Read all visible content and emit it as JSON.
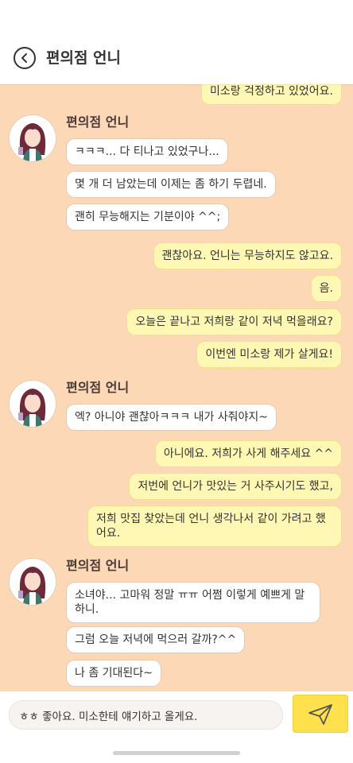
{
  "header": {
    "title": "편의점 언니",
    "back_icon": "chevron-left-icon"
  },
  "chat": {
    "contact_name": "편의점 언니",
    "messages": [
      {
        "side": "out",
        "text": "미소랑 걱정하고 있었어요."
      },
      {
        "side": "in",
        "text": "ㅋㅋㅋ... 다 티나고 있었구나..."
      },
      {
        "side": "in",
        "text": "몇 개 더 남았는데 이제는 좀 하기 두렵네."
      },
      {
        "side": "in",
        "text": "괜히 무능해지는 기분이야 ^^;"
      },
      {
        "side": "out",
        "text": "괜찮아요. 언니는 무능하지도 않고요."
      },
      {
        "side": "out",
        "text": "음."
      },
      {
        "side": "out",
        "text": "오늘은 끝나고 저희랑 같이 저녁 먹을래요?"
      },
      {
        "side": "out",
        "text": "이번엔 미소랑 제가 살게요!"
      },
      {
        "side": "in",
        "text": "엑? 아니야 괜찮아ㅋㅋㅋ 내가 사줘야지~"
      },
      {
        "side": "out",
        "text": "아니에요. 저희가 사게 해주세요 ^^"
      },
      {
        "side": "out",
        "text": "저번에 언니가 맛있는 거 사주시기도 했고,"
      },
      {
        "side": "out",
        "text": "저희 맛집 찾았는데 언니 생각나서 같이 가려고 했어요."
      },
      {
        "side": "in",
        "text": "소녀야... 고마워 정말 ㅠㅠ 어쩜 이렇게 예쁘게 말하니."
      },
      {
        "side": "in",
        "text": "그럼 오늘 저녁에 먹으러 갈까?^^"
      },
      {
        "side": "in",
        "text": "나 좀 기대된다~"
      }
    ]
  },
  "composer": {
    "value": "ㅎㅎ 좋아요. 미소한테 얘기하고 올게요.",
    "send_icon": "paper-plane-icon"
  },
  "colors": {
    "chat_background": "#fcd8b6",
    "outgoing_bubble": "#fff8b5",
    "incoming_bubble": "#ffffff",
    "send_button": "#ffe14d"
  }
}
